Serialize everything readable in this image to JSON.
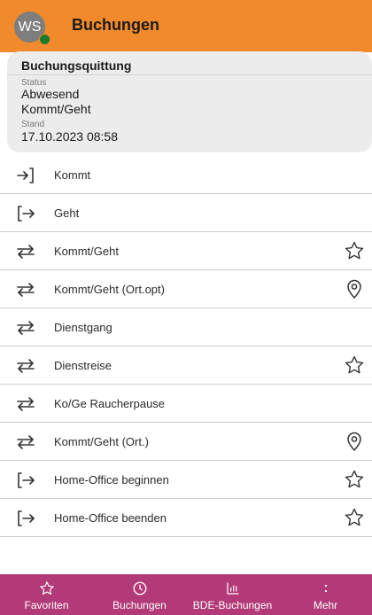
{
  "header": {
    "avatar_initials": "WS",
    "title": "Buchungen",
    "presence_color": "#1f7a2e",
    "accent_color": "#f08a2c"
  },
  "receipt": {
    "title": "Buchungsquittung",
    "status_label": "Status",
    "status_line1": "Abwesend",
    "status_line2": "Kommt/Geht",
    "stand_label": "Stand",
    "stand_value": "17.10.2023 08:58"
  },
  "actions": [
    {
      "label": "Kommt",
      "icon": "login-icon",
      "trailing": ""
    },
    {
      "label": "Geht",
      "icon": "logout-icon",
      "trailing": ""
    },
    {
      "label": "Kommt/Geht",
      "icon": "swap-icon",
      "trailing": "star-icon"
    },
    {
      "label": "Kommt/Geht (Ort.opt)",
      "icon": "swap-icon",
      "trailing": "location-icon"
    },
    {
      "label": "Dienstgang",
      "icon": "swap-icon",
      "trailing": ""
    },
    {
      "label": "Dienstreise",
      "icon": "swap-icon",
      "trailing": "star-icon"
    },
    {
      "label": "Ko/Ge Raucherpause",
      "icon": "swap-icon",
      "trailing": ""
    },
    {
      "label": "Kommt/Geht (Ort.)",
      "icon": "swap-icon",
      "trailing": "location-icon"
    },
    {
      "label": "Home-Office beginnen",
      "icon": "logout-icon",
      "trailing": "star-icon"
    },
    {
      "label": "Home-Office beenden",
      "icon": "logout-icon",
      "trailing": "star-icon"
    }
  ],
  "bottom_nav": {
    "background_color": "#b23a78",
    "items": [
      {
        "label": "Favoriten",
        "icon": "star-icon"
      },
      {
        "label": "Buchungen",
        "icon": "clock-icon"
      },
      {
        "label": "BDE-Buchungen",
        "icon": "bar-chart-icon"
      },
      {
        "label": "Mehr",
        "icon": "more-vertical-icon"
      }
    ]
  }
}
